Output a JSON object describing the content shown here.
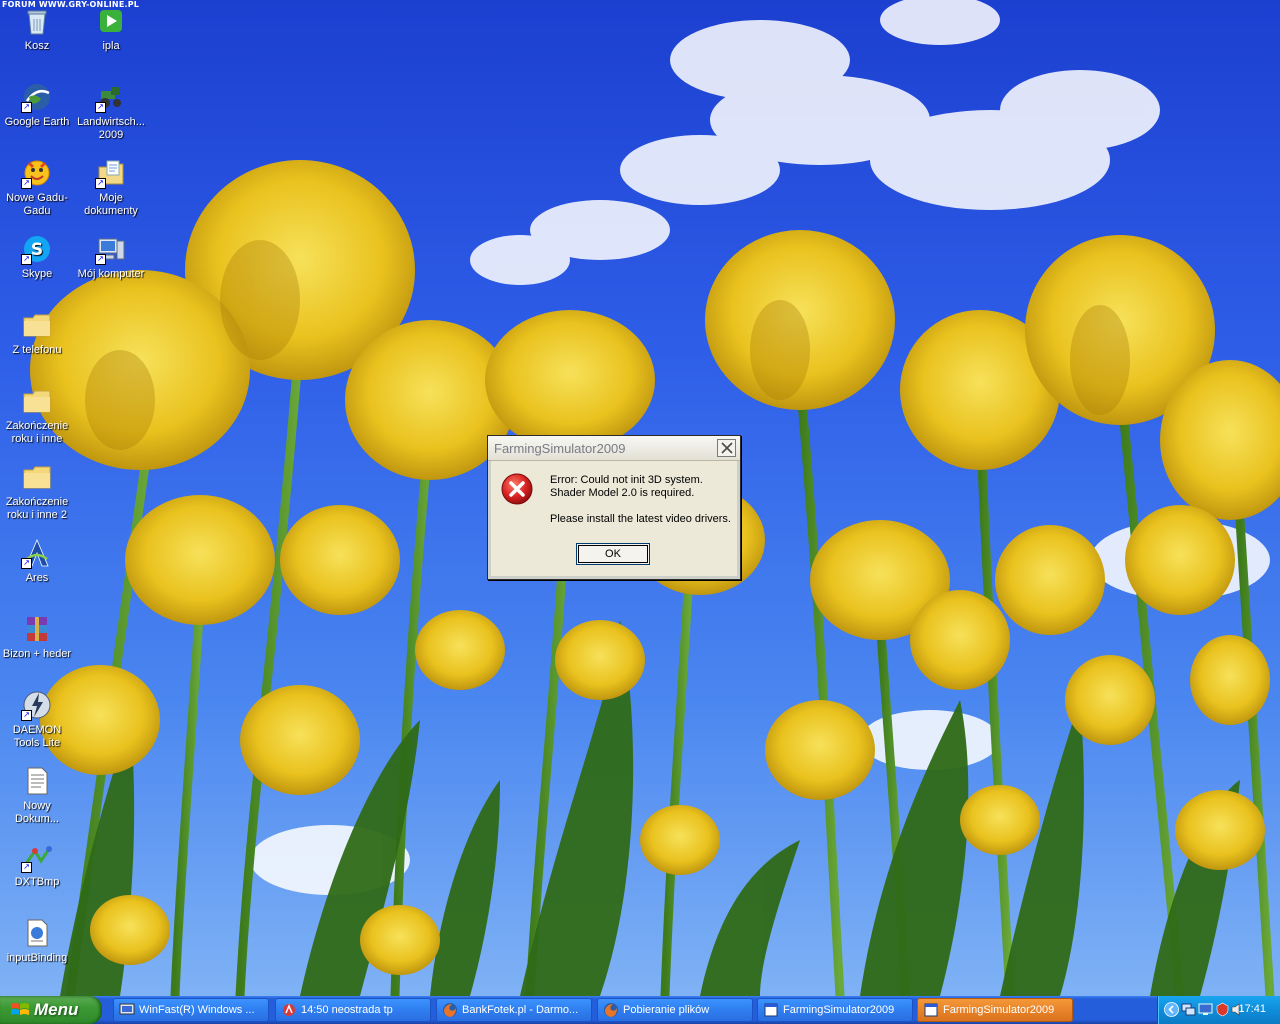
{
  "watermark": "FORUM WWW.GRY-ONLINE.PL",
  "desktop_icons": [
    {
      "label": "Kosz",
      "icon": "recycle-bin-icon"
    },
    {
      "label": "ipla",
      "icon": "ipla-icon"
    },
    {
      "label": "Google Earth",
      "icon": "google-earth-icon"
    },
    {
      "label": "Landwirtsch... 2009",
      "icon": "tractor-icon"
    },
    {
      "label": "Nowe Gadu-Gadu",
      "icon": "gadu-gadu-icon"
    },
    {
      "label": "Moje dokumenty",
      "icon": "my-documents-icon"
    },
    {
      "label": "Skype",
      "icon": "skype-icon"
    },
    {
      "label": "Mój komputer",
      "icon": "my-computer-icon"
    },
    {
      "label": "Z telefonu",
      "icon": "folder-icon"
    },
    {
      "label": "Zakończenie roku i inne",
      "icon": "folder-icon"
    },
    {
      "label": "Zakończenie roku i inne 2",
      "icon": "folder-icon"
    },
    {
      "label": "Ares",
      "icon": "ares-icon"
    },
    {
      "label": "Bizon + heder",
      "icon": "winrar-icon"
    },
    {
      "label": "DAEMON Tools Lite",
      "icon": "daemon-tools-icon"
    },
    {
      "label": "Nowy Dokum...",
      "icon": "text-document-icon"
    },
    {
      "label": "DXTBmp",
      "icon": "dxtbmp-icon"
    },
    {
      "label": "inputBinding",
      "icon": "config-file-icon"
    }
  ],
  "dialog": {
    "title": "FarmingSimulator2009",
    "line1": "Error: Could not init 3D system.",
    "line2": "Shader Model 2.0 is required.",
    "line3": "Please install the latest video drivers.",
    "ok_label": "OK"
  },
  "taskbar": {
    "start_label": "Menu",
    "tasks": [
      {
        "label": "WinFast(R) Windows ...",
        "icon": "tv-icon",
        "active": false
      },
      {
        "label": "14:50 neostrada tp",
        "icon": "neostrada-icon",
        "active": false
      },
      {
        "label": "BankFotek.pl - Darmo...",
        "icon": "firefox-icon",
        "active": false
      },
      {
        "label": "Pobieranie plików",
        "icon": "firefox-icon",
        "active": false
      },
      {
        "label": "FarmingSimulator2009",
        "icon": "app-window-icon",
        "active": false
      },
      {
        "label": "FarmingSimulator2009",
        "icon": "app-window-icon",
        "active": true
      }
    ],
    "clock": "17:41"
  },
  "colors": {
    "taskbar_blue": "#245edb",
    "start_green": "#3c9a34",
    "active_task_orange": "#e8842a",
    "tray_blue": "#0f8ddb",
    "dialog_bg": "#ece9d8",
    "error_red": "#d62020"
  }
}
